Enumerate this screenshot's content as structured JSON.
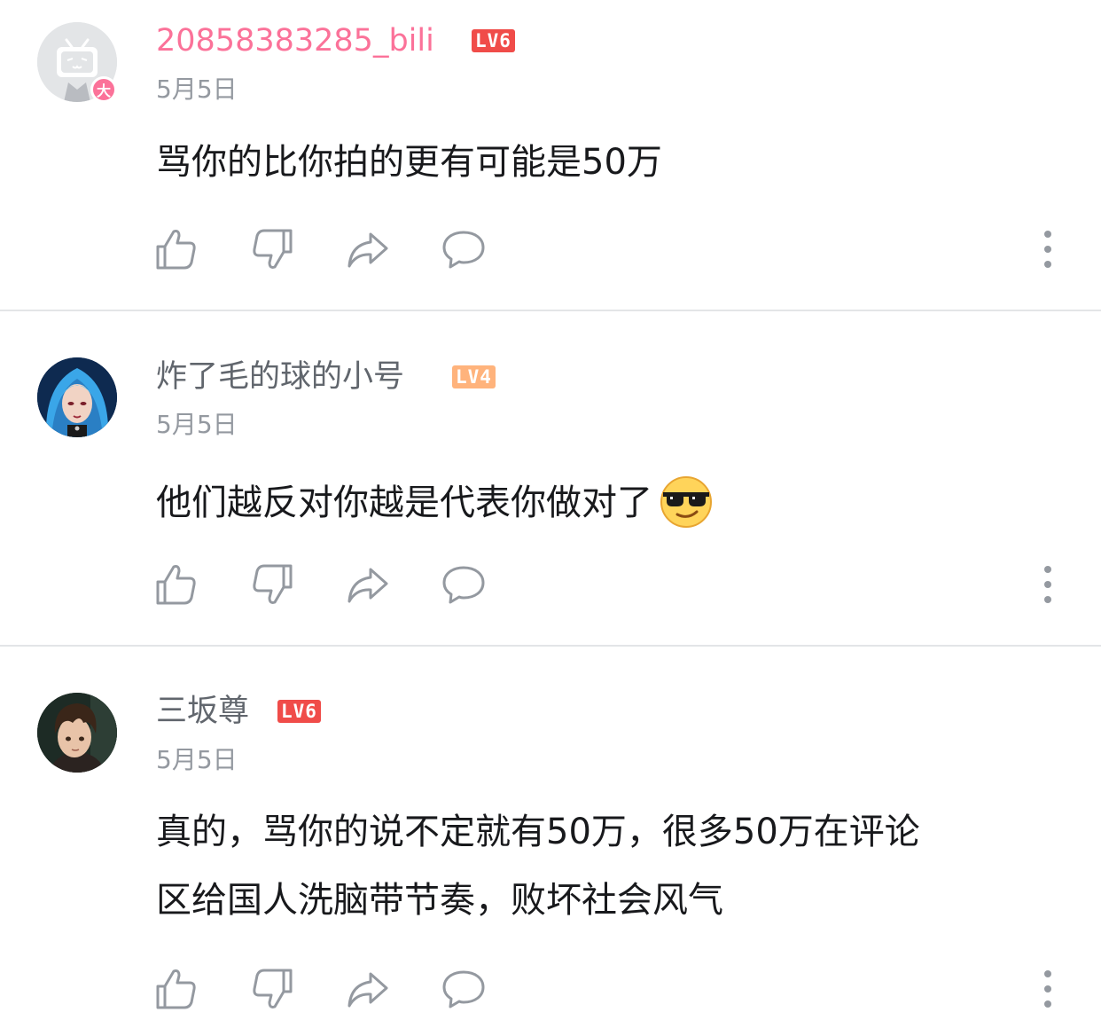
{
  "comments": [
    {
      "username": "20858383285_bili",
      "level": "LV6",
      "vip_badge": "大",
      "date": "5月5日",
      "content": "骂你的比你拍的更有可能是50万",
      "avatar": "bilibili-tv-default-avatar"
    },
    {
      "username": "炸了毛的球的小号",
      "level": "LV4",
      "date": "5月5日",
      "content": "他们越反对你越是代表你做对了",
      "emoji": "sunglasses-emoji",
      "avatar": "blue-hair-character-avatar"
    },
    {
      "username": "三坂尊",
      "level": "LV6",
      "date": "5月5日",
      "content_lines": [
        "真的，骂你的说不定就有50万，很多50万在评论",
        "区给国人洗脑带节奏，败坏社会风气"
      ],
      "avatar": "anime-boy-avatar"
    }
  ],
  "actions": {
    "like_icon": "thumbs-up-icon",
    "dislike_icon": "thumbs-down-icon",
    "share_icon": "share-icon",
    "reply_icon": "reply-icon",
    "more_icon": "more-vertical-icon"
  },
  "colors": {
    "vip_name": "#fb7299",
    "normal_name": "#61666d",
    "level6": "#f04c49",
    "level4": "#ffb37c",
    "date": "#9499a0",
    "icon": "#9499a0",
    "divider": "#e3e5e7"
  }
}
